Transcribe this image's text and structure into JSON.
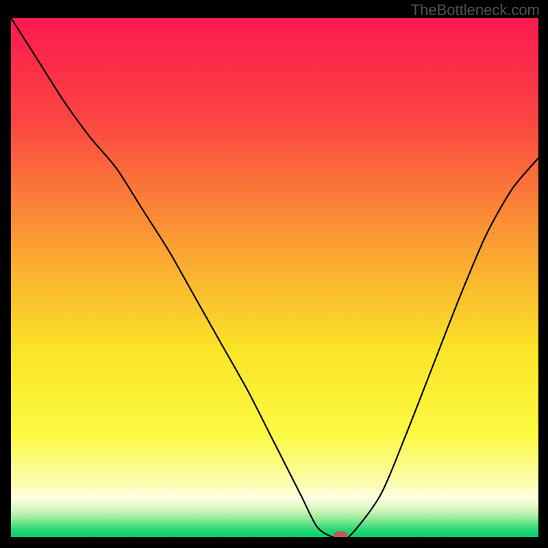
{
  "attribution": "TheBottleneck.com",
  "chart_data": {
    "type": "line",
    "title": "",
    "xlabel": "",
    "ylabel": "",
    "xlim": [
      0,
      100
    ],
    "ylim": [
      0,
      100
    ],
    "grid": false,
    "legend": false,
    "background_gradient": {
      "stops": [
        {
          "offset": 0.0,
          "color": "#fb1950"
        },
        {
          "offset": 0.2,
          "color": "#fb4641"
        },
        {
          "offset": 0.45,
          "color": "#fba432"
        },
        {
          "offset": 0.64,
          "color": "#fae427"
        },
        {
          "offset": 0.8,
          "color": "#fbfa41"
        },
        {
          "offset": 0.895,
          "color": "#fcfdae"
        },
        {
          "offset": 0.925,
          "color": "#fdfee3"
        },
        {
          "offset": 0.945,
          "color": "#dcf8c0"
        },
        {
          "offset": 0.965,
          "color": "#93eb97"
        },
        {
          "offset": 0.985,
          "color": "#2bd877"
        },
        {
          "offset": 1.0,
          "color": "#00d26c"
        }
      ]
    },
    "series": [
      {
        "name": "bottleneck-curve",
        "color": "#000000",
        "x": [
          0,
          5,
          10,
          15,
          20,
          25,
          30,
          35,
          40,
          45,
          50,
          55,
          58,
          61,
          64,
          70,
          75,
          80,
          85,
          90,
          95,
          100
        ],
        "values": [
          100,
          92,
          84,
          77,
          71,
          63,
          55,
          46,
          37,
          28,
          18,
          8,
          2,
          0,
          0,
          8,
          20,
          33,
          46,
          58,
          67,
          73
        ]
      }
    ],
    "marker": {
      "name": "optimal-point",
      "x": 62.5,
      "y": 0,
      "color": "#bb5a56",
      "rx": 10,
      "ry": 6
    }
  }
}
